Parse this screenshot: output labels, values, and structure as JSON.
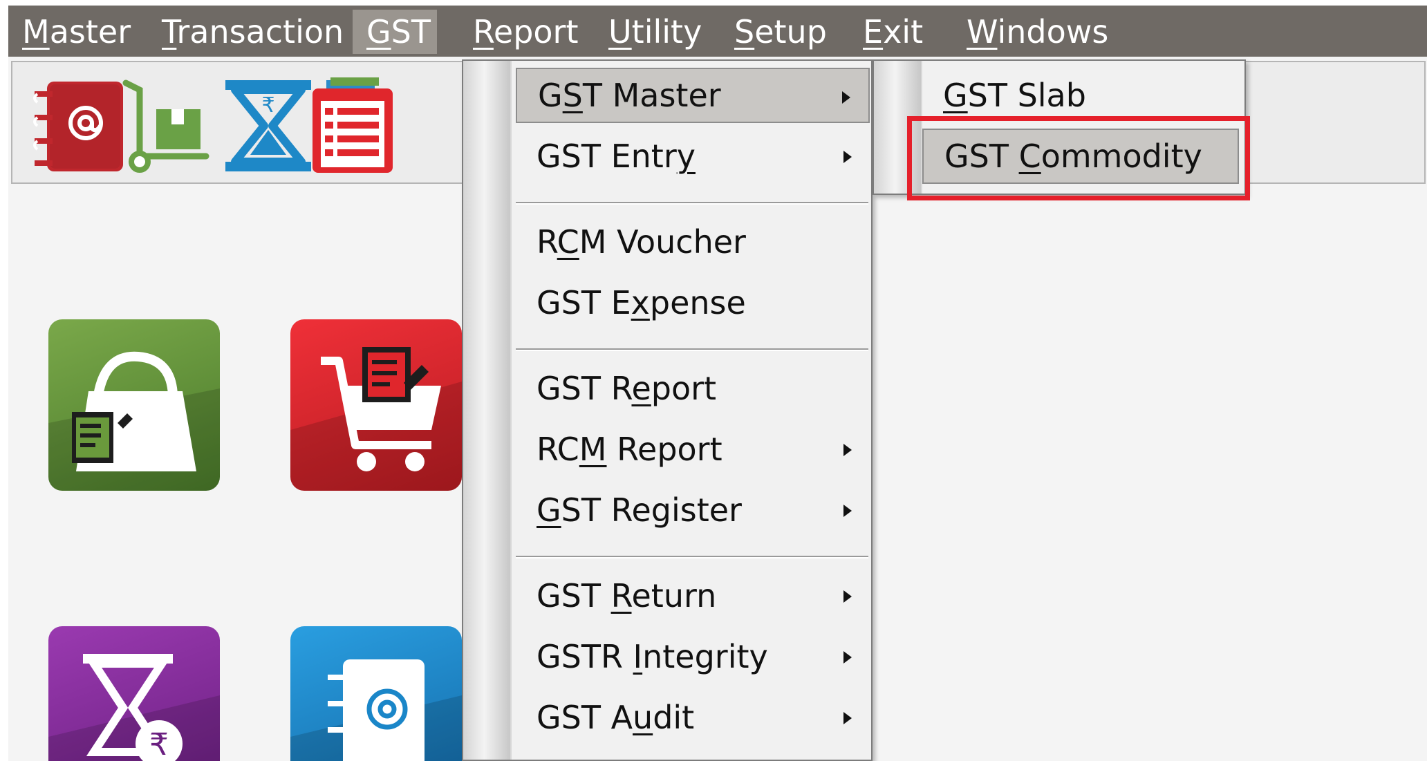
{
  "menubar": {
    "items": [
      {
        "label": "Master",
        "accel": "M"
      },
      {
        "label": "Transaction",
        "accel": "T"
      },
      {
        "label": "GST",
        "accel": "G"
      },
      {
        "label": "Report",
        "accel": "R"
      },
      {
        "label": "Utility",
        "accel": "U"
      },
      {
        "label": "Setup",
        "accel": "S"
      },
      {
        "label": "Exit",
        "accel": "E"
      },
      {
        "label": "Windows",
        "accel": "W"
      }
    ],
    "active": "GST"
  },
  "gst_menu": {
    "items": [
      {
        "pre": "G",
        "u": "S",
        "post": "T Master",
        "submenu": true
      },
      {
        "pre": "GST Entr",
        "u": "y",
        "post": "",
        "submenu": true
      },
      {
        "pre": "R",
        "u": "C",
        "post": "M Voucher",
        "submenu": false
      },
      {
        "pre": "GST E",
        "u": "x",
        "post": "pense",
        "submenu": false
      },
      {
        "pre": "GST R",
        "u": "e",
        "post": "port",
        "submenu": false
      },
      {
        "pre": "RC",
        "u": "M",
        "post": " Report",
        "submenu": true
      },
      {
        "pre": "",
        "u": "G",
        "post": "ST Register",
        "submenu": true
      },
      {
        "pre": "GST ",
        "u": "R",
        "post": "eturn",
        "submenu": true
      },
      {
        "pre": "GSTR ",
        "u": "I",
        "post": "ntegrity",
        "submenu": true
      },
      {
        "pre": "GST A",
        "u": "u",
        "post": "dit",
        "submenu": true
      }
    ]
  },
  "gst_master_submenu": {
    "items": [
      {
        "pre": "",
        "u": "G",
        "post": "ST Slab"
      },
      {
        "pre": "GST ",
        "u": "C",
        "post": "ommodity"
      }
    ],
    "highlighted": "GST Commodity"
  },
  "colors": {
    "menubar_bg": "#6f6a65",
    "highlight_box": "#e5202b",
    "tile_green": "#5f8f3a",
    "tile_red": "#d8232a",
    "tile_purple": "#7b2a8f",
    "tile_blue": "#1a86c8"
  },
  "toolbar_icons": [
    "address-book-icon",
    "hand-truck-icon",
    "hourglass-rupee-icon",
    "clipboard-list-icon"
  ],
  "tiles": [
    "purchase-bag-tile",
    "sales-cart-tile",
    "payment-hourglass-tile",
    "contacts-book-tile"
  ]
}
